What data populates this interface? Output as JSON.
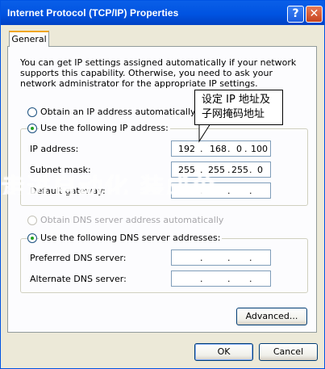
{
  "window": {
    "title": "Internet Protocol (TCP/IP) Properties",
    "help_glyph": "?",
    "close_glyph": "✕"
  },
  "tabs": [
    {
      "label": "General"
    }
  ],
  "description": "You can get IP settings assigned automatically if your network supports this capability. Otherwise, you need to ask your network administrator for the appropriate IP settings.",
  "ip": {
    "auto_label": "Obtain an IP address automatically",
    "manual_label": "Use the following IP address:",
    "fields": [
      {
        "label": "IP address:",
        "octets": [
          "192",
          "168",
          "0",
          "100"
        ]
      },
      {
        "label": "Subnet mask:",
        "octets": [
          "255",
          "255",
          "255",
          "0"
        ]
      },
      {
        "label": "Default gateway:",
        "octets": [
          "",
          "",
          "",
          ""
        ]
      }
    ]
  },
  "dns": {
    "auto_label": "Obtain DNS server address automatically",
    "manual_label": "Use the following DNS server addresses:",
    "fields": [
      {
        "label": "Preferred DNS server:",
        "octets": [
          "",
          "",
          "",
          ""
        ]
      },
      {
        "label": "Alternate DNS server:",
        "octets": [
          "",
          "",
          "",
          ""
        ]
      }
    ]
  },
  "annotation": {
    "line1": "设定 IP 地址及",
    "line2": "子网掩码地址"
  },
  "watermark": "走进自动化 装成公",
  "buttons": {
    "advanced": "Advanced...",
    "ok": "OK",
    "cancel": "Cancel"
  },
  "colors": {
    "title_bar": "#0053e1",
    "radio_dot": "#21a121",
    "tab_accent": "#f1a61c"
  }
}
